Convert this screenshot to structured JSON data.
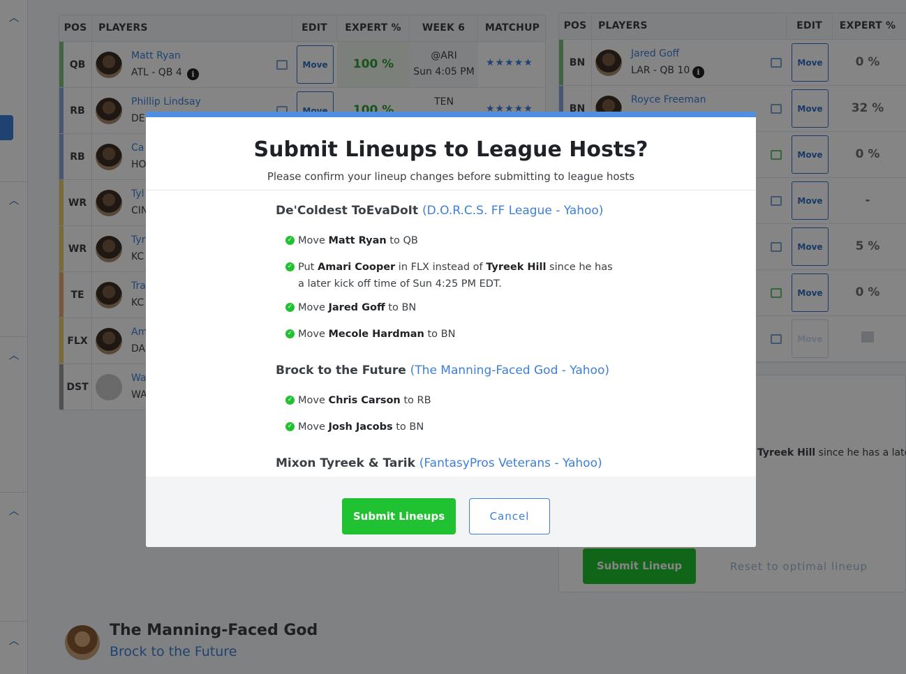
{
  "left_table": {
    "headers": [
      "POS",
      "PLAYERS",
      "EDIT",
      "EXPERT %",
      "WEEK 6",
      "MATCHUP"
    ],
    "rows": [
      {
        "pos": "QB",
        "name": "Matt Ryan",
        "team": "ATL - QB 4",
        "edit": "Move",
        "expert": "100 %",
        "week": "@ARI",
        "time": "Sun 4:05 PM",
        "stars": "★★★★★",
        "bar": "#7fc07f"
      },
      {
        "pos": "RB",
        "name": "Phillip Lindsay",
        "team": "DE",
        "edit": "Move",
        "expert": "100 %",
        "week": "TEN",
        "time": "",
        "stars": "★★★★★",
        "bar": "#8aa4e0"
      },
      {
        "pos": "RB",
        "name": "Ca",
        "team": "HO",
        "edit": "",
        "expert": "",
        "week": "",
        "time": "",
        "stars": "",
        "bar": "#8aa4e0"
      },
      {
        "pos": "WR",
        "name": "Tyl",
        "team": "CIN",
        "edit": "",
        "expert": "",
        "week": "",
        "time": "",
        "stars": "",
        "bar": "#e8cc6a"
      },
      {
        "pos": "WR",
        "name": "Tyr",
        "team": "KC",
        "edit": "",
        "expert": "",
        "week": "",
        "time": "",
        "stars": "",
        "bar": "#e8cc6a"
      },
      {
        "pos": "TE",
        "name": "Tra",
        "team": "KC",
        "edit": "",
        "expert": "",
        "week": "",
        "time": "",
        "stars": "",
        "bar": "#e8a96a"
      },
      {
        "pos": "FLX",
        "name": "Am",
        "team": "DA",
        "edit": "",
        "expert": "",
        "week": "",
        "time": "",
        "stars": "",
        "bar": "#e8cc6a"
      },
      {
        "pos": "DST",
        "name": "Wa",
        "team": "WA",
        "edit": "",
        "expert": "",
        "week": "",
        "time": "",
        "stars": "",
        "bar": "#9a9a9a"
      }
    ]
  },
  "right_table": {
    "headers": [
      "POS",
      "PLAYERS",
      "EDIT",
      "EXPERT %"
    ],
    "rows": [
      {
        "pos": "BN",
        "name": "Jared Goff",
        "team": "LAR - QB 10",
        "edit": "Move",
        "expert": "0 %"
      },
      {
        "pos": "BN",
        "name": "Royce Freeman",
        "team": "",
        "edit": "Move",
        "expert": "32 %"
      },
      {
        "pos": "",
        "name": "",
        "team": "",
        "edit": "Move",
        "expert": "0 %"
      },
      {
        "pos": "",
        "name": "",
        "team": "",
        "edit": "Move",
        "expert": "-"
      },
      {
        "pos": "",
        "name": "",
        "team": "",
        "edit": "Move",
        "expert": "5 %"
      },
      {
        "pos": "",
        "name": "",
        "team": "",
        "edit": "Move",
        "expert": "0 %"
      },
      {
        "pos": "",
        "name": "",
        "team": "",
        "edit": "Move",
        "expert": ""
      }
    ]
  },
  "background": {
    "partial_text_bold": "Tyreek Hill",
    "partial_text_rest": "since he has a later",
    "submit_lineup": "Submit Lineup",
    "reset_lineup": "Reset to optimal lineup",
    "team_title": "The Manning-Faced God",
    "team_subtitle": "Brock to the Future"
  },
  "modal": {
    "title": "Submit Lineups to League Hosts?",
    "subtitle": "Please confirm your lineup changes before submitting to league hosts",
    "leagues": [
      {
        "team": "De'Coldest ToEvaDoIt",
        "league": "(D.O.R.C.S. FF League - Yahoo)",
        "changes": [
          {
            "pre": "Move ",
            "player": "Matt Ryan",
            "post": " to QB"
          },
          {
            "pre": "Put ",
            "player": "Amari Cooper",
            "mid": " in FLX instead of ",
            "player2": "Tyreek Hill",
            "post": " since he has a later kick off time of Sun 4:25 PM EDT."
          },
          {
            "pre": "Move ",
            "player": "Jared Goff",
            "post": " to BN"
          },
          {
            "pre": "Move ",
            "player": "Mecole Hardman",
            "post": " to BN"
          }
        ]
      },
      {
        "team": "Brock to the Future",
        "league": "(The Manning-Faced God - Yahoo)",
        "changes": [
          {
            "pre": "Move ",
            "player": "Chris Carson",
            "post": " to RB"
          },
          {
            "pre": "Move ",
            "player": "Josh Jacobs",
            "post": " to BN"
          }
        ]
      },
      {
        "team": "Mixon Tyreek & Tarik",
        "league": "(FantasyPros Veterans - Yahoo)",
        "changes": []
      }
    ],
    "submit_label": "Submit Lineups",
    "cancel_label": "Cancel"
  },
  "colors": {
    "accent_blue": "#3d7fd6",
    "success_green": "#21c231",
    "modal_top_bar": "#4f8fe0"
  }
}
